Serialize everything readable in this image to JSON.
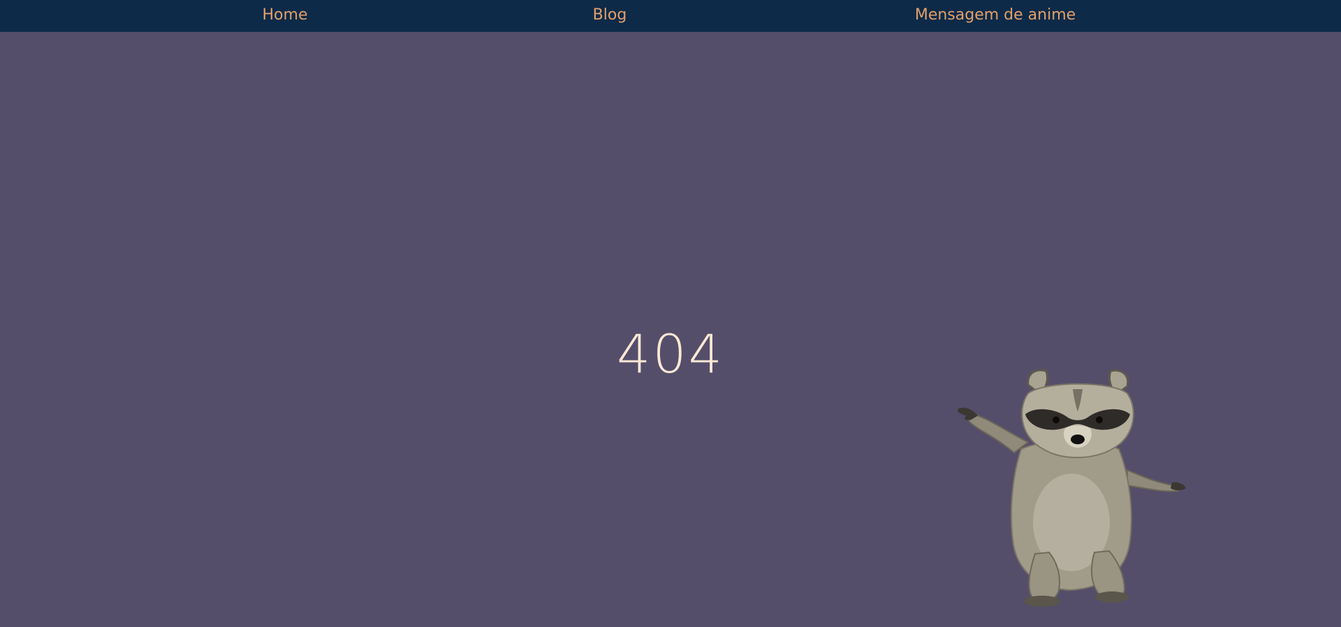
{
  "nav": {
    "items": [
      {
        "label": "Home"
      },
      {
        "label": "Blog"
      },
      {
        "label": "Mensagem de anime"
      }
    ]
  },
  "main": {
    "error_code": "404",
    "mascot_icon": "raccoon-image"
  },
  "colors": {
    "background": "#554e6a",
    "navbar": "#0d2a48",
    "nav_link": "#e2a06a",
    "error_code": "#fbe8d5"
  }
}
